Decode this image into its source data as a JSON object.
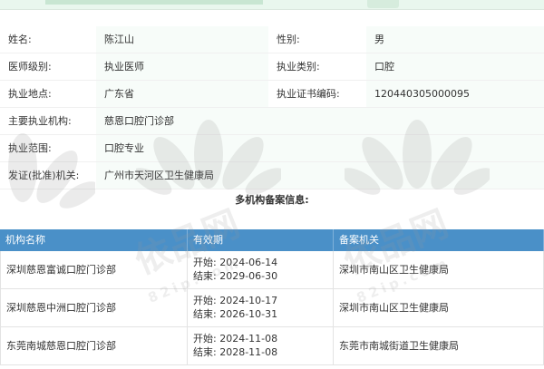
{
  "info": {
    "rows": [
      {
        "label1": "姓名:",
        "value1": "陈江山",
        "label2": "性别:",
        "value2": "男"
      },
      {
        "label1": "医师级别:",
        "value1": "执业医师",
        "label2": "执业类别:",
        "value2": "口腔"
      },
      {
        "label1": "执业地点:",
        "value1": "广东省",
        "label2": "执业证书编码:",
        "value2": "120440305000095"
      }
    ],
    "wide_rows": [
      {
        "label": "主要执业机构:",
        "value": "慈恩口腔门诊部"
      },
      {
        "label": "执业范围:",
        "value": "口腔专业"
      },
      {
        "label": "发证(批准)机关:",
        "value": "广州市天河区卫生健康局"
      }
    ]
  },
  "multi_filing": {
    "title": "多机构备案信息:",
    "headers": {
      "name": "机构名称",
      "validity": "有效期",
      "authority": "备案机关"
    },
    "rows": [
      {
        "name": "深圳慈恩富诚口腔门诊部",
        "start": "开始: 2024-06-14",
        "end": "结束: 2029-06-30",
        "authority": "深圳市南山区卫生健康局"
      },
      {
        "name": "深圳慈恩中洲口腔门诊部",
        "start": "开始: 2024-10-17",
        "end": "结束: 2026-10-31",
        "authority": "深圳市南山区卫生健康局"
      },
      {
        "name": "东莞南城慈恩口腔门诊部",
        "start": "开始: 2024-11-08",
        "end": "结束: 2028-11-08",
        "authority": "东莞市南城街道卫生健康局"
      }
    ]
  },
  "watermark": {
    "brand_cn": "依品网",
    "brand_url": "82ip.com"
  },
  "colors": {
    "header_blue": "#4a90c8",
    "value_bg": "#f7fcf9",
    "top_bar": "#e9f7ee"
  }
}
